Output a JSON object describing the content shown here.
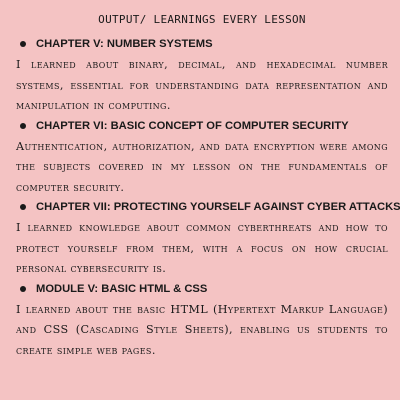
{
  "document": {
    "title": "OUTPUT/ LEARNINGS EVERY LESSON",
    "sections": [
      {
        "heading": "CHAPTER V: NUMBER SYSTEMS",
        "body": "I learned about binary, decimal, and hexadecimal number systems, essential for understanding data representation and manipulation in computing."
      },
      {
        "heading": "CHAPTER VI: BASIC CONCEPT OF COMPUTER SECURITY",
        "body": "Authentication, authorization, and data encryption were among the subjects covered in my lesson on the fundamentals of computer security."
      },
      {
        "heading": "CHAPTER VII: PROTECTING YOURSELF AGAINST CYBER ATTACKS",
        "body": "I learned knowledge about common cyberthreats and how to protect yourself from them, with a focus on how crucial personal cybersecurity is."
      },
      {
        "heading": "MODULE V: BASIC HTML & CSS",
        "body": "I learned about the basic HTML (Hypertext Markup Language) and CSS (Cascading Style Sheets), enabling us students to create simple web pages."
      }
    ]
  }
}
